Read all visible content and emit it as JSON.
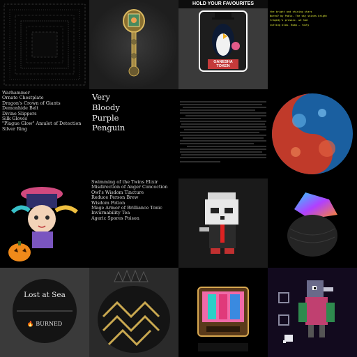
{
  "grid_items": [
    {
      "id": "ascii-frame"
    },
    {
      "id": "golden-key"
    },
    {
      "id": "hold-favourites",
      "banner": "HOLD YOUR FAVOURITES",
      "token_top": "GANESHA",
      "token_bottom": "TOKEN"
    },
    {
      "id": "green-poem",
      "lines": [
        "the bright and shining stars",
        "Bored? by Pablo. The sky shines bright",
        "tragedy's prosaic. we had",
        "cutting blow. Bump — rusty"
      ]
    },
    {
      "id": "item-list",
      "items": [
        "Warhammer",
        "Ornate Chestplate",
        "Dragon's Crown of Giants",
        "Demonhide Belt",
        "Divine Slippers",
        "Silk Gloves",
        "\"Plague Glow\" Amulet of Detection",
        "Silver Ring"
      ]
    },
    {
      "id": "very-bloody",
      "lines": [
        "Very",
        "Bloody",
        "Purple",
        "Penguin"
      ]
    },
    {
      "id": "glitch-lines"
    },
    {
      "id": "swirl-circle"
    },
    {
      "id": "pumpkin-girl"
    },
    {
      "id": "potion-list",
      "items": [
        "Swimming of the Twins Elixir",
        "Misdirection of Anger Concoction",
        "Owl's Wisdom Tincture",
        "Reduce Person Brew",
        "Wisdom Potion",
        "Mage Armor of Brilliance Tonic",
        "Invurnability Tea",
        "Ageric Spores Poison"
      ]
    },
    {
      "id": "raccoon-figure"
    },
    {
      "id": "iridescent-rock"
    },
    {
      "id": "lost-at-sea",
      "title": "Lost at Sea",
      "status": "BURNED"
    },
    {
      "id": "gold-skull"
    },
    {
      "id": "retro-tv"
    },
    {
      "id": "pixel-bird"
    }
  ],
  "colors": {
    "poem": "#e6f23a",
    "text": "#e8e8e8"
  }
}
